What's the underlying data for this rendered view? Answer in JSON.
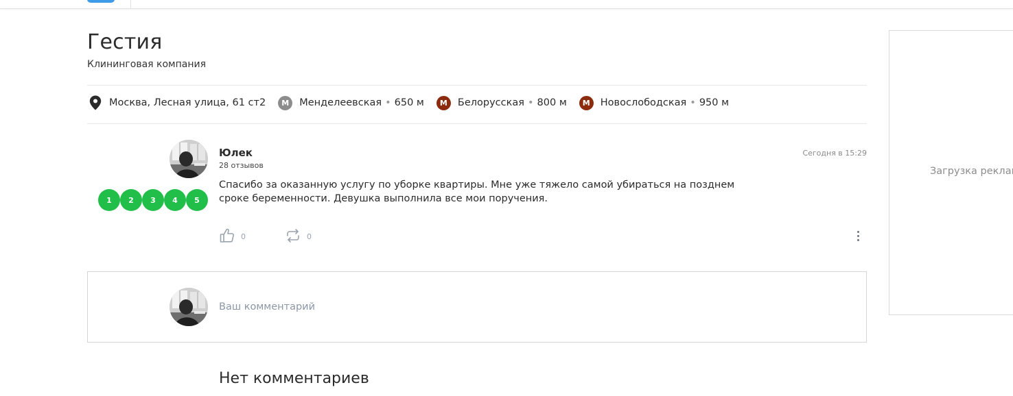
{
  "header": {
    "logo_color": "#3d9be9"
  },
  "company": {
    "name": "Гестия",
    "type": "Клининговая компания"
  },
  "location": {
    "address": "Москва, Лесная улица, 61 ст2",
    "stations": [
      {
        "letter": "М",
        "name": "Менделеевская",
        "distance": "650 м",
        "color": "#8c8c8c"
      },
      {
        "letter": "М",
        "name": "Белорусская",
        "distance": "800 м",
        "color": "#8b2a0c"
      },
      {
        "letter": "М",
        "name": "Новослободская",
        "distance": "950 м",
        "color": "#8b2a0c"
      }
    ],
    "separator": "•"
  },
  "review": {
    "author": "Юлек",
    "reviews_count": "28 отзывов",
    "timestamp": "Сегодня в 15:29",
    "rating_buttons": [
      "1",
      "2",
      "3",
      "4",
      "5"
    ],
    "rating_color": "#21bf4a",
    "text": "Спасибо за оказанную услугу по уборке квартиры. Мне уже тяжело самой убираться на позднем сроке беременности. Девушка выполнила все мои поручения.",
    "likes": "0",
    "reposts": "0"
  },
  "comment_form": {
    "placeholder": "Ваш комментарий"
  },
  "comments": {
    "empty_label": "Нет комментариев"
  },
  "ad": {
    "loading_text": "Загрузка реклам"
  }
}
